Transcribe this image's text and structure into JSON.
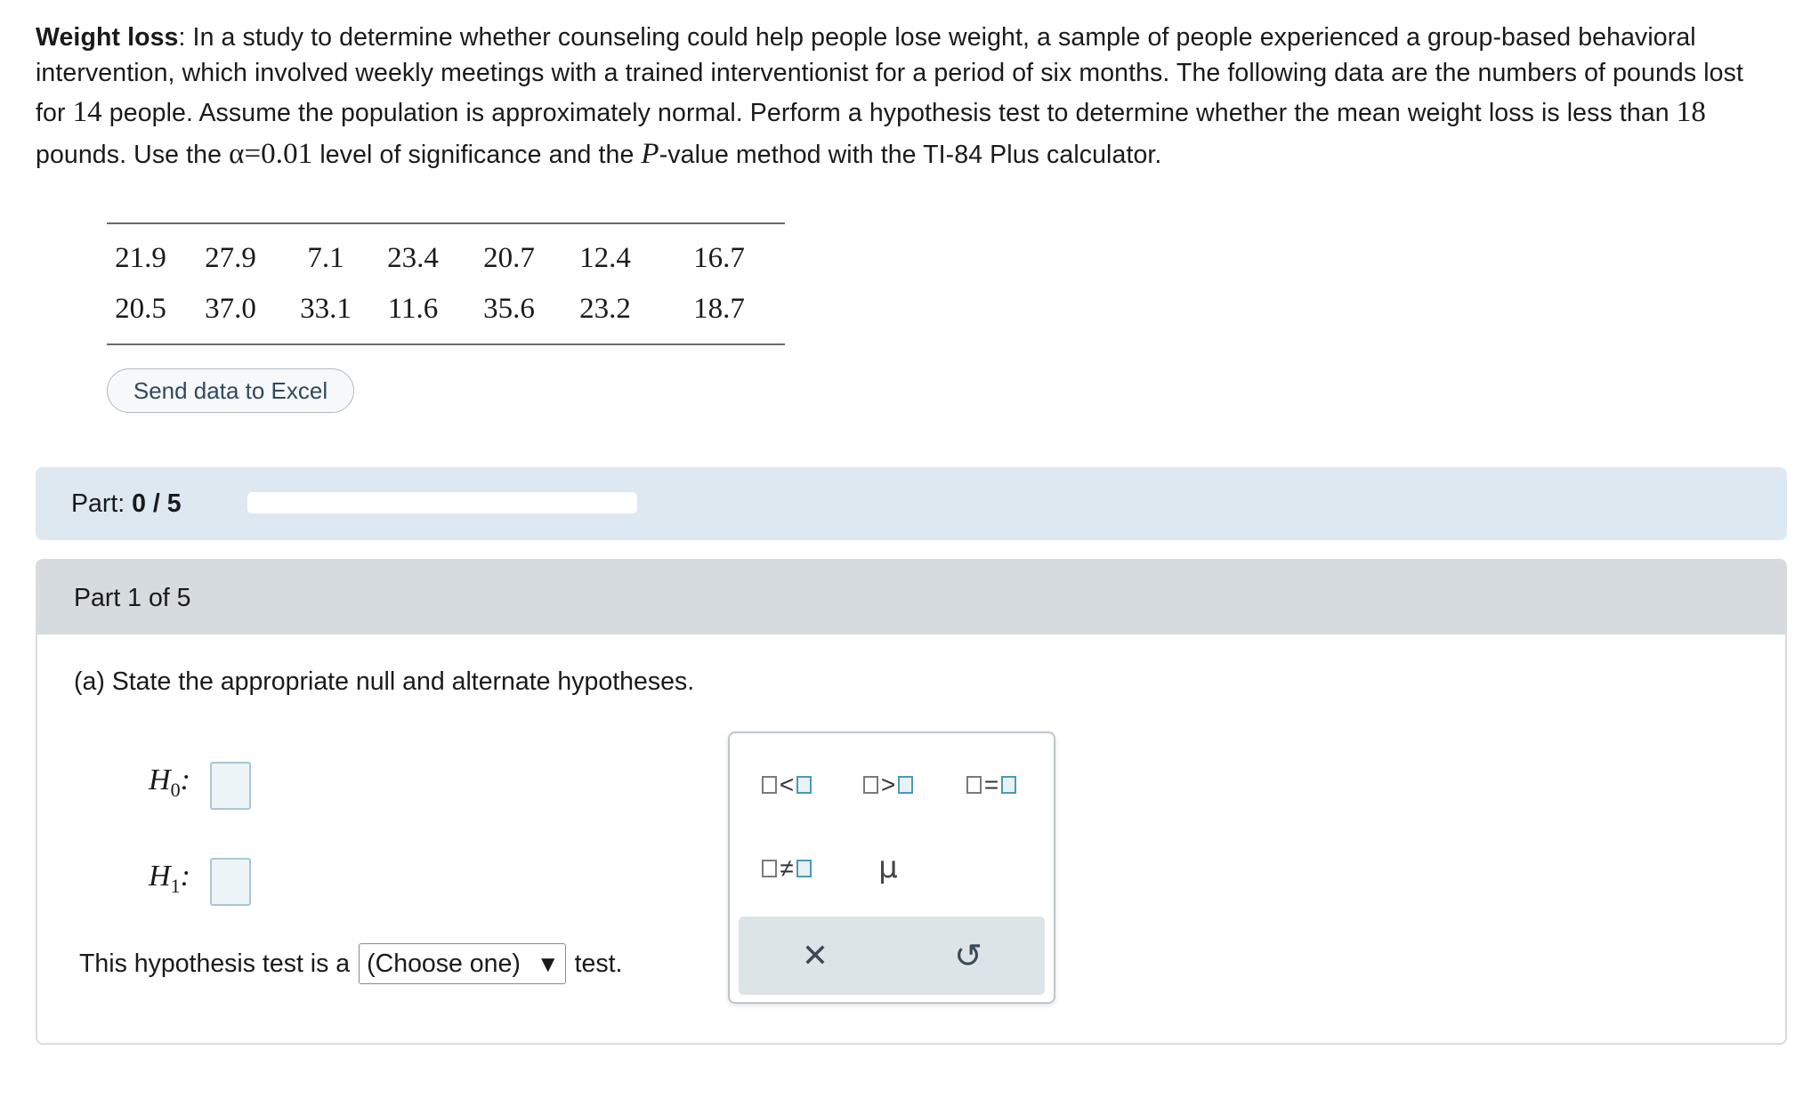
{
  "problem": {
    "title": "Weight loss",
    "s1": ": In a study to determine whether counseling could help people lose weight, a sample of people experienced a group-based behavioral intervention, which involved weekly meetings with a trained interventionist for a period of six months. The following data are the numbers of pounds lost for ",
    "n": "14",
    "s2": " people. Assume the population is approximately normal. Perform a hypothesis test to determine whether the mean weight loss is less than ",
    "mu0": "18",
    "s3": " pounds. Use the ",
    "alpha": "α=0.01",
    "s4": " level of significance and the ",
    "p": "P",
    "s5": "-value method with the TI-84 Plus calculator."
  },
  "data_rows": [
    [
      "21.9",
      "27.9",
      "7.1",
      "23.4",
      "20.7",
      "12.4",
      "16.7"
    ],
    [
      "20.5",
      "37.0",
      "33.1",
      "11.6",
      "35.6",
      "23.2",
      "18.7"
    ]
  ],
  "excel_button": "Send data to Excel",
  "part": {
    "label": "Part:",
    "progress_text": "0 / 5",
    "progress_fraction": 0.0,
    "header": "Part 1 of 5"
  },
  "question": "(a) State the appropriate null and alternate hypotheses.",
  "h0": {
    "var": "H",
    "sub": "0",
    "colon": ":"
  },
  "h1": {
    "var": "H",
    "sub": "1",
    "colon": ":"
  },
  "test_sentence": {
    "before": "This hypothesis test is a",
    "select_value": "(Choose one)",
    "after": "test."
  },
  "keypad": {
    "lt": "<",
    "gt": ">",
    "eq": "=",
    "neq": "≠",
    "mu": "μ",
    "clear": "✕",
    "undo": "↺"
  }
}
